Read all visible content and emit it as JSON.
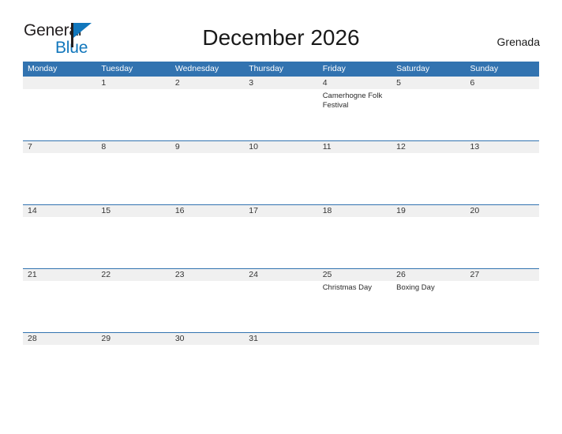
{
  "brand": {
    "name_part_1": "General",
    "name_part_2": "Blue",
    "color_dark": "#231f20",
    "color_blue": "#1277bc"
  },
  "header": {
    "title": "December 2026",
    "region": "Grenada"
  },
  "theme": {
    "header_blue": "#3273b0",
    "band_gray": "#f0f0f0",
    "page_background": "#ffffff"
  },
  "calendar": {
    "month": "December",
    "year": "2026",
    "week_start": "Monday",
    "weekdays": [
      "Monday",
      "Tuesday",
      "Wednesday",
      "Thursday",
      "Friday",
      "Saturday",
      "Sunday"
    ],
    "weeks": [
      {
        "days": [
          {
            "num": "",
            "events": []
          },
          {
            "num": "1",
            "events": []
          },
          {
            "num": "2",
            "events": []
          },
          {
            "num": "3",
            "events": []
          },
          {
            "num": "4",
            "events": [
              "Camerhogne Folk Festival"
            ]
          },
          {
            "num": "5",
            "events": []
          },
          {
            "num": "6",
            "events": []
          }
        ]
      },
      {
        "days": [
          {
            "num": "7",
            "events": []
          },
          {
            "num": "8",
            "events": []
          },
          {
            "num": "9",
            "events": []
          },
          {
            "num": "10",
            "events": []
          },
          {
            "num": "11",
            "events": []
          },
          {
            "num": "12",
            "events": []
          },
          {
            "num": "13",
            "events": []
          }
        ]
      },
      {
        "days": [
          {
            "num": "14",
            "events": []
          },
          {
            "num": "15",
            "events": []
          },
          {
            "num": "16",
            "events": []
          },
          {
            "num": "17",
            "events": []
          },
          {
            "num": "18",
            "events": []
          },
          {
            "num": "19",
            "events": []
          },
          {
            "num": "20",
            "events": []
          }
        ]
      },
      {
        "days": [
          {
            "num": "21",
            "events": []
          },
          {
            "num": "22",
            "events": []
          },
          {
            "num": "23",
            "events": []
          },
          {
            "num": "24",
            "events": []
          },
          {
            "num": "25",
            "events": [
              "Christmas Day"
            ]
          },
          {
            "num": "26",
            "events": [
              "Boxing Day"
            ]
          },
          {
            "num": "27",
            "events": []
          }
        ]
      },
      {
        "days": [
          {
            "num": "28",
            "events": []
          },
          {
            "num": "29",
            "events": []
          },
          {
            "num": "30",
            "events": []
          },
          {
            "num": "31",
            "events": []
          },
          {
            "num": "",
            "events": []
          },
          {
            "num": "",
            "events": []
          },
          {
            "num": "",
            "events": []
          }
        ]
      }
    ]
  }
}
